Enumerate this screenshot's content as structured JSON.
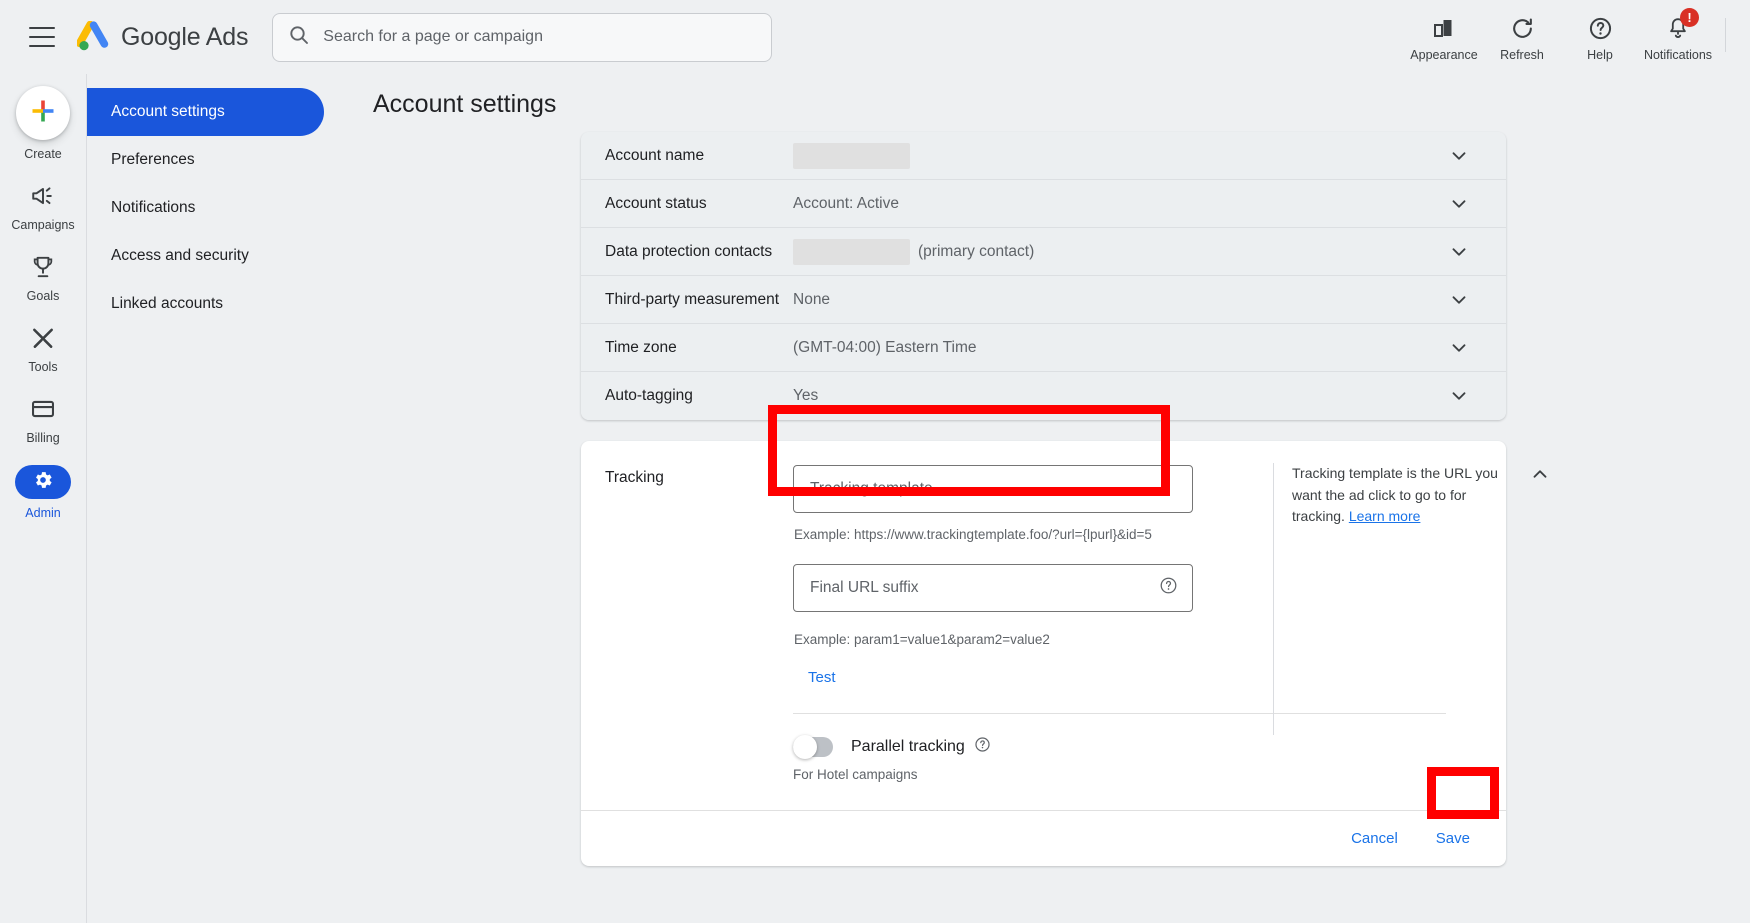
{
  "topbar": {
    "menu_icon": "hamburger-icon",
    "brand": "Google Ads",
    "brand_google": "Google",
    "brand_ads": "Ads",
    "search_placeholder": "Search for a page or campaign",
    "icons": [
      {
        "name": "appearance",
        "label": "Appearance",
        "icon": "appearance-icon"
      },
      {
        "name": "refresh",
        "label": "Refresh",
        "icon": "refresh-icon"
      },
      {
        "name": "help",
        "label": "Help",
        "icon": "help-icon"
      },
      {
        "name": "notifications",
        "label": "Notifications",
        "icon": "bell-icon",
        "badge": "!"
      }
    ]
  },
  "rail": {
    "items": [
      {
        "label": "Create",
        "icon": "plus-icon",
        "active": false
      },
      {
        "label": "Campaigns",
        "icon": "megaphone-icon",
        "active": false
      },
      {
        "label": "Goals",
        "icon": "trophy-icon",
        "active": false
      },
      {
        "label": "Tools",
        "icon": "tools-icon",
        "active": false
      },
      {
        "label": "Billing",
        "icon": "credit-card-icon",
        "active": false
      },
      {
        "label": "Admin",
        "icon": "gear-icon",
        "active": true
      }
    ]
  },
  "settings_nav": {
    "items": [
      {
        "label": "Account settings",
        "active": true
      },
      {
        "label": "Preferences",
        "active": false
      },
      {
        "label": "Notifications",
        "active": false
      },
      {
        "label": "Access and security",
        "active": false
      },
      {
        "label": "Linked accounts",
        "active": false
      }
    ]
  },
  "page": {
    "title": "Account settings"
  },
  "settings_rows": [
    {
      "label": "Account name",
      "value": "",
      "redacted": true,
      "suffix": "",
      "chevron": "chevron-down-icon"
    },
    {
      "label": "Account status",
      "value": "Account: Active",
      "redacted": false,
      "suffix": "",
      "chevron": "chevron-down-icon"
    },
    {
      "label": "Data protection contacts",
      "value": "",
      "redacted": true,
      "suffix": "(primary contact)",
      "chevron": "chevron-down-icon"
    },
    {
      "label": "Third-party measurement",
      "value": "None",
      "redacted": false,
      "suffix": "",
      "chevron": "chevron-down-icon"
    },
    {
      "label": "Time zone",
      "value": "(GMT-04:00) Eastern Time",
      "redacted": false,
      "suffix": "",
      "chevron": "chevron-down-icon"
    },
    {
      "label": "Auto-tagging",
      "value": "Yes",
      "redacted": false,
      "suffix": "",
      "chevron": "chevron-down-icon"
    }
  ],
  "tracking": {
    "label": "Tracking",
    "template_placeholder": "Tracking template",
    "template_value": "",
    "template_example": "Example: https://www.trackingtemplate.foo/?url={lpurl}&id=5",
    "suffix_placeholder": "Final URL suffix",
    "suffix_value": "",
    "suffix_example": "Example: param1=value1&param2=value2",
    "test_label": "Test",
    "parallel_label": "Parallel tracking",
    "parallel_note": "For Hotel campaigns",
    "parallel_on": false,
    "help_text": "Tracking template is the URL you want the ad click to go to for tracking. ",
    "help_link": "Learn more",
    "collapse_icon": "chevron-up-icon",
    "cancel_label": "Cancel",
    "save_label": "Save"
  },
  "colors": {
    "accent_blue": "#1a56db",
    "link_blue": "#1a73e8",
    "highlight_red": "#ff0000",
    "page_bg": "#eef0f2"
  }
}
